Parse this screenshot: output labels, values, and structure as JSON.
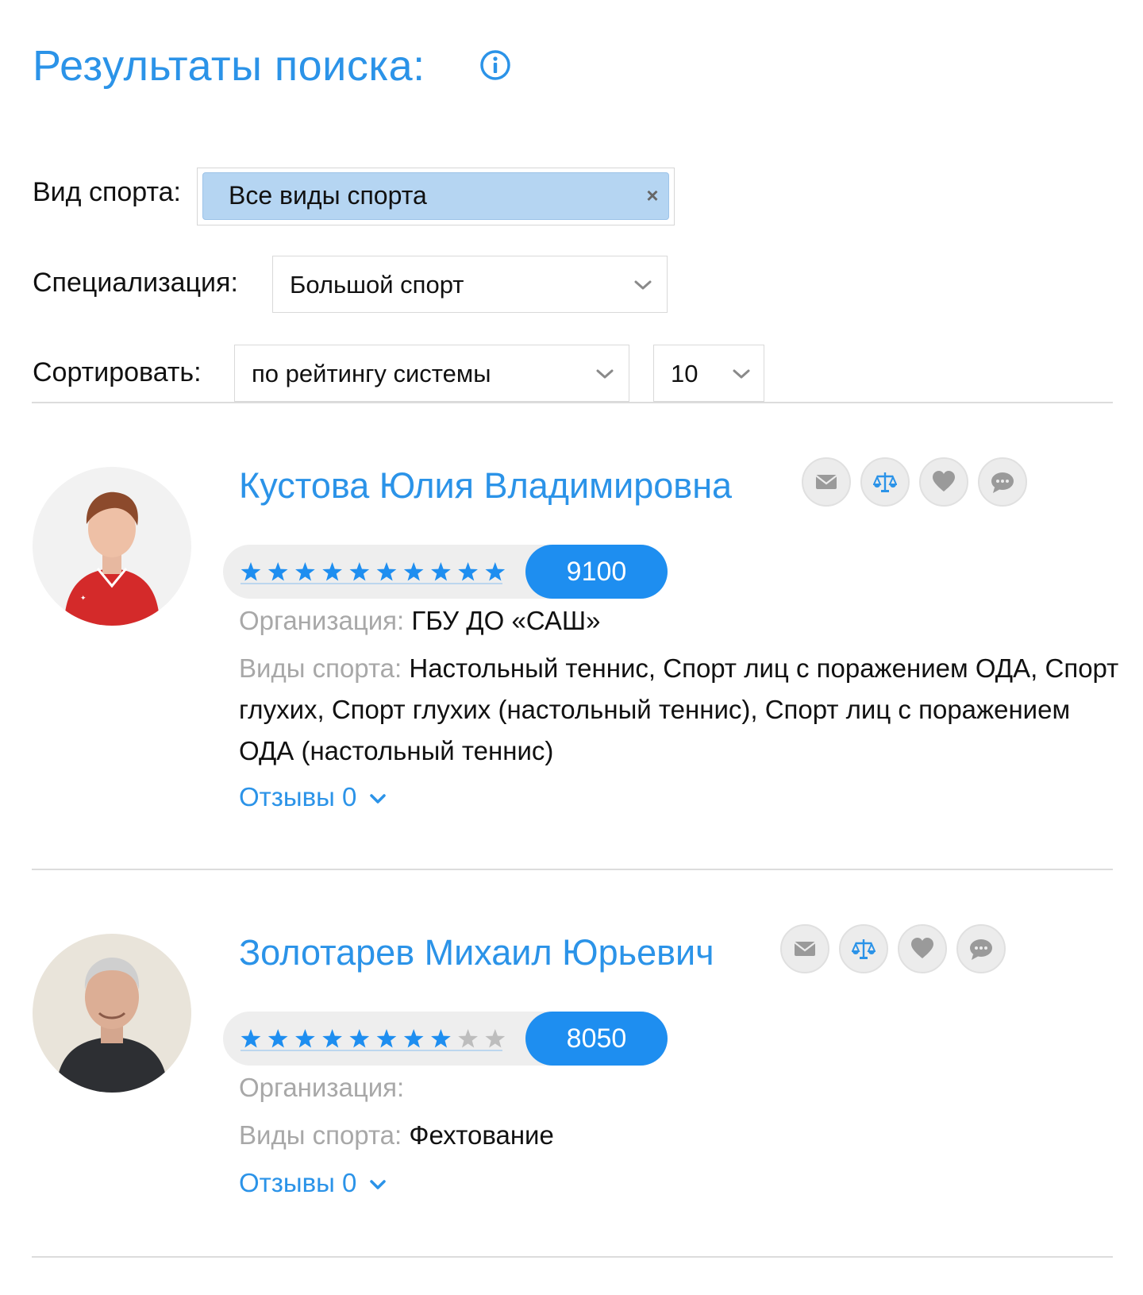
{
  "page": {
    "title": "Результаты поиска:",
    "info_icon": "info-circle-icon"
  },
  "filters": {
    "sport_label": "Вид спорта:",
    "sport_tag": "Все виды спорта",
    "sport_tag_remove": "×",
    "specialization_label": "Специализация:",
    "specialization_value": "Большой спорт",
    "sort_label": "Сортировать:",
    "sort_value": "по рейтингу системы",
    "per_page_value": "10"
  },
  "results": [
    {
      "name": "Кустова Юлия Владимировна",
      "stars_filled": 10,
      "stars_total": 11,
      "score": "9100",
      "org_label": "Организация:",
      "org_value": " ГБУ ДО «САШ»",
      "sports_label": "Виды спорта:",
      "sports_value": " Настольный теннис, Спорт лиц с поражением ОДА, Спорт глухих, Спорт глухих (настольный теннис), Спорт лиц с поражением ОДА (настольный теннис)",
      "reviews": "Отзывы 0",
      "actions": [
        "mail-icon",
        "scales-icon",
        "heart-icon",
        "chat-icon"
      ]
    },
    {
      "name": "Золотарев Михаил Юрьевич",
      "stars_filled": 8,
      "stars_total": 10,
      "score": "8050",
      "org_label": "Организация:",
      "org_value": "",
      "sports_label": "Виды спорта:",
      "sports_value": " Фехтование",
      "reviews": "Отзывы 0",
      "actions": [
        "mail-icon",
        "scales-icon",
        "heart-icon",
        "chat-icon"
      ]
    }
  ],
  "colors": {
    "accent": "#2b93e8",
    "score_bg": "#1e8ef0",
    "star_filled": "#1e8ef0",
    "star_empty": "#bdbdbd",
    "tag_bg": "#b5d5f2",
    "label_grey": "#a8a8a8"
  }
}
